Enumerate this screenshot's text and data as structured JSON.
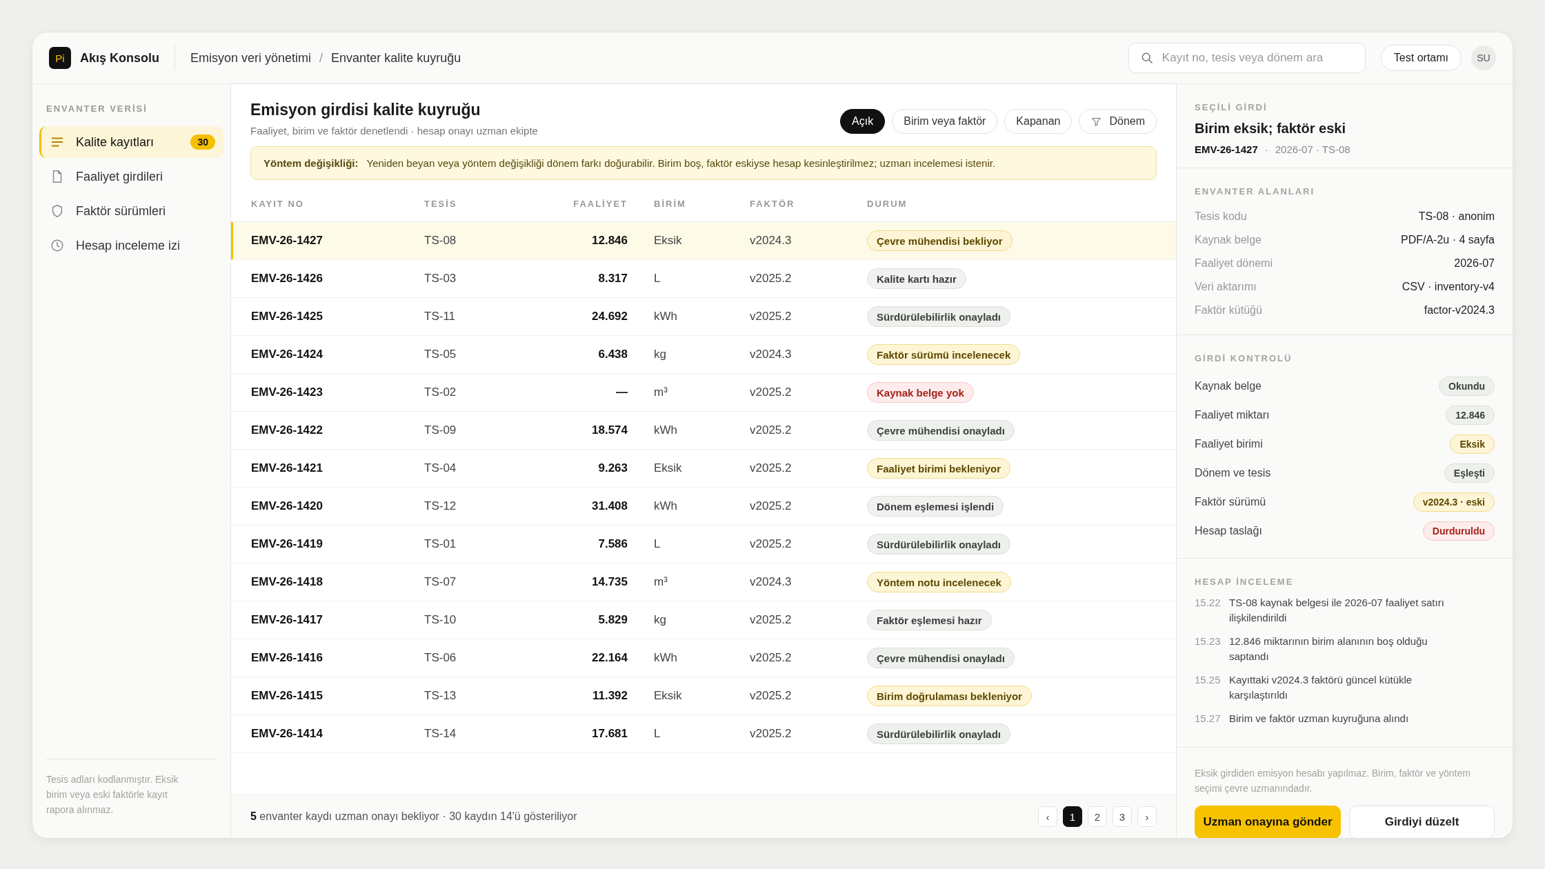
{
  "app": {
    "logo": "Pi",
    "name": "Akış Konsolu"
  },
  "breadcrumb": [
    "Emisyon veri yönetimi",
    "/",
    "Envanter kalite kuyruğu"
  ],
  "search": {
    "placeholder": "Kayıt no, tesis veya dönem ara"
  },
  "environment": "Test ortamı",
  "user": {
    "initials": "SU"
  },
  "sidebar": {
    "section": "ENVANTER VERİSİ",
    "items": [
      {
        "label": "Kalite kayıtları",
        "count": "30",
        "selected": true
      },
      {
        "label": "Faaliyet girdileri",
        "selected": false
      },
      {
        "label": "Faktör sürümleri",
        "selected": false
      },
      {
        "label": "Hesap inceleme izi",
        "selected": false
      }
    ],
    "note": "Tesis adları kodlanmıştır. Eksik birim veya eski faktörle kayıt rapora alınmaz."
  },
  "queue": {
    "title": "Emisyon girdisi kalite kuyruğu",
    "subtitle": "Faaliyet, birim ve faktör denetlendi · hesap onayı uzman ekipte",
    "filters": [
      {
        "label": "Açık",
        "kind": "chip",
        "selected": true
      },
      {
        "label": "Birim veya faktör",
        "kind": "chip",
        "selected": false
      },
      {
        "label": "Kapanan",
        "kind": "chip",
        "selected": false
      },
      {
        "label": "Dönem",
        "kind": "filter",
        "selected": false
      }
    ],
    "alert": {
      "title": "Yöntem değişikliği:",
      "text": "Yeniden beyan veya yöntem değişikliği dönem farkı doğurabilir. Birim boş, faktör eskiyse hesap kesinleştirilmez; uzman incelemesi istenir."
    },
    "columns": [
      "KAYIT NO",
      "TESİS",
      "FAALİYET",
      "BİRİM",
      "FAKTÖR",
      "DURUM"
    ],
    "rows": [
      {
        "id": "EMV-26-1427",
        "site": "TS-08",
        "activity": "12.846",
        "unit": "Eksik",
        "factor": "v2024.3",
        "status": "Çevre mühendisi bekliyor",
        "color": "#fdf5d5",
        "selected": true
      },
      {
        "id": "EMV-26-1426",
        "site": "TS-03",
        "activity": "8.317",
        "unit": "L",
        "factor": "v2025.2",
        "status": "Kalite kartı hazır",
        "color": "#f1f1ef",
        "selected": false
      },
      {
        "id": "EMV-26-1425",
        "site": "TS-11",
        "activity": "24.692",
        "unit": "kWh",
        "factor": "v2025.2",
        "status": "Sürdürülebilirlik onayladı",
        "color": "#eef0ed",
        "selected": false
      },
      {
        "id": "EMV-26-1424",
        "site": "TS-05",
        "activity": "6.438",
        "unit": "kg",
        "factor": "v2024.3",
        "status": "Faktör sürümü incelenecek",
        "color": "#fdf5d5",
        "selected": false
      },
      {
        "id": "EMV-26-1423",
        "site": "TS-02",
        "activity": "—",
        "unit": "m³",
        "factor": "v2025.2",
        "status": "Kaynak belge yok",
        "color": "#fdeceb",
        "selected": false
      },
      {
        "id": "EMV-26-1422",
        "site": "TS-09",
        "activity": "18.574",
        "unit": "kWh",
        "factor": "v2025.2",
        "status": "Çevre mühendisi onayladı",
        "color": "#eef0ed",
        "selected": false
      },
      {
        "id": "EMV-26-1421",
        "site": "TS-04",
        "activity": "9.263",
        "unit": "Eksik",
        "factor": "v2025.2",
        "status": "Faaliyet birimi bekleniyor",
        "color": "#fdf5d5",
        "selected": false
      },
      {
        "id": "EMV-26-1420",
        "site": "TS-12",
        "activity": "31.408",
        "unit": "kWh",
        "factor": "v2025.2",
        "status": "Dönem eşlemesi işlendi",
        "color": "#f1f1ef",
        "selected": false
      },
      {
        "id": "EMV-26-1419",
        "site": "TS-01",
        "activity": "7.586",
        "unit": "L",
        "factor": "v2025.2",
        "status": "Sürdürülebilirlik onayladı",
        "color": "#eef0ed",
        "selected": false
      },
      {
        "id": "EMV-26-1418",
        "site": "TS-07",
        "activity": "14.735",
        "unit": "m³",
        "factor": "v2024.3",
        "status": "Yöntem notu incelenecek",
        "color": "#fdf5d5",
        "selected": false
      },
      {
        "id": "EMV-26-1417",
        "site": "TS-10",
        "activity": "5.829",
        "unit": "kg",
        "factor": "v2025.2",
        "status": "Faktör eşlemesi hazır",
        "color": "#f1f1ef",
        "selected": false
      },
      {
        "id": "EMV-26-1416",
        "site": "TS-06",
        "activity": "22.164",
        "unit": "kWh",
        "factor": "v2025.2",
        "status": "Çevre mühendisi onayladı",
        "color": "#eef0ed",
        "selected": false
      },
      {
        "id": "EMV-26-1415",
        "site": "TS-13",
        "activity": "11.392",
        "unit": "Eksik",
        "factor": "v2025.2",
        "status": "Birim doğrulaması bekleniyor",
        "color": "#fdf5d5",
        "selected": false
      },
      {
        "id": "EMV-26-1414",
        "site": "TS-14",
        "activity": "17.681",
        "unit": "L",
        "factor": "v2025.2",
        "status": "Sürdürülebilirlik onayladı",
        "color": "#eef0ed",
        "selected": false
      }
    ],
    "footer": "**5** envanter kaydı uzman onayı bekliyor · 30 kaydın 14'ü gösteriliyor",
    "pagination": {
      "prev": "‹",
      "next": "›",
      "pages": [
        {
          "label": "1",
          "selected": true
        },
        {
          "label": "2",
          "selected": false
        },
        {
          "label": "3",
          "selected": false
        }
      ]
    }
  },
  "detail": {
    "section": "SEÇİLİ GİRDİ",
    "title": "Birim eksik; faktör eski",
    "record_id": "EMV-26-1427",
    "separator": "·",
    "meta": "2026-07 · TS-08",
    "fields_title": "ENVANTER ALANLARI",
    "fields": [
      {
        "label": "Tesis kodu",
        "value": "TS-08 · anonim"
      },
      {
        "label": "Kaynak belge",
        "value": "PDF/A-2u · 4 sayfa"
      },
      {
        "label": "Faaliyet dönemi",
        "value": "2026-07"
      },
      {
        "label": "Veri aktarımı",
        "value": "CSV · inventory-v4"
      },
      {
        "label": "Faktör kütüğü",
        "value": "factor-v2024.3"
      }
    ],
    "checks_title": "GİRDİ KONTROLÜ",
    "checks": [
      {
        "label": "Kaynak belge",
        "value": "Okundu",
        "color": "#eef0ed"
      },
      {
        "label": "Faaliyet miktarı",
        "value": "12.846",
        "color": "#eef0ed"
      },
      {
        "label": "Faaliyet birimi",
        "value": "Eksik",
        "color": "#fdf5d5"
      },
      {
        "label": "Dönem ve tesis",
        "value": "Eşleşti",
        "color": "#eef0ed"
      },
      {
        "label": "Faktör sürümü",
        "value": "v2024.3 · eski",
        "color": "#fdf5d5"
      },
      {
        "label": "Hesap taslağı",
        "value": "Durduruldu",
        "color": "#fdeceb"
      }
    ],
    "log_title": "HESAP İNCELEME",
    "log": [
      {
        "time": "15.22",
        "text": "TS-08 kaynak belgesi ile 2026-07 faaliyet satırı ilişkilendirildi"
      },
      {
        "time": "15.23",
        "text": "12.846 miktarının birim alanının boş olduğu saptandı"
      },
      {
        "time": "15.25",
        "text": "Kayıttaki v2024.3 faktörü güncel kütükle karşılaştırıldı"
      },
      {
        "time": "15.27",
        "text": "Birim ve faktör uzman kuyruğuna alındı"
      }
    ],
    "note": "Eksik girdiden emisyon hesabı yapılmaz. Birim, faktör ve yöntem seçimi çevre uzmanındadır.",
    "primary_action": "Uzman onayına gönder",
    "secondary_action": "Girdiyi düzelt"
  }
}
